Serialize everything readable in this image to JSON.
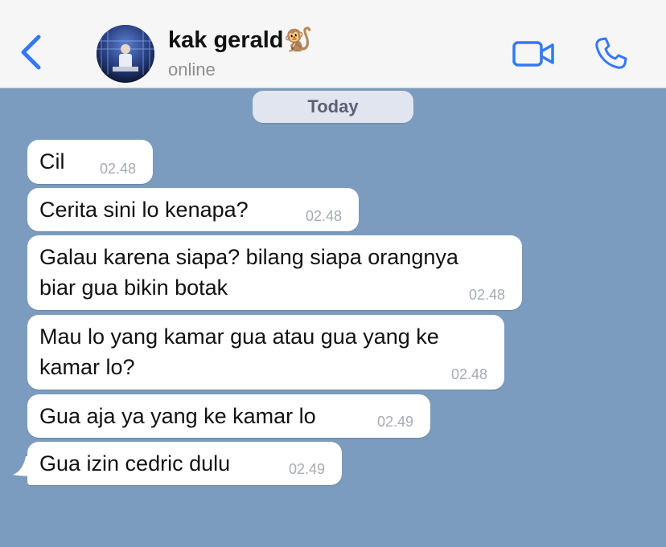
{
  "header": {
    "contact_name": "kak gerald",
    "contact_emoji": "🐒",
    "status": "online"
  },
  "chat": {
    "date_label": "Today",
    "messages": [
      {
        "lines": [
          "Cil"
        ],
        "time": "02.48"
      },
      {
        "lines": [
          "Cerita sini lo kenapa?"
        ],
        "time": "02.48"
      },
      {
        "lines": [
          "Galau karena siapa? bilang siapa orangnya",
          "biar gua bikin botak"
        ],
        "time": "02.48"
      },
      {
        "lines": [
          "Mau lo yang kamar gua atau gua yang ke",
          "kamar lo?"
        ],
        "time": "02.48"
      },
      {
        "lines": [
          "Gua aja ya yang ke kamar lo"
        ],
        "time": "02.49"
      },
      {
        "lines": [
          "Gua izin cedric dulu"
        ],
        "time": "02.49"
      }
    ]
  },
  "colors": {
    "accent": "#3478f6",
    "chat_background": "#7b9cbe",
    "bubble": "#ffffff",
    "header": "#f6f6f6"
  },
  "icons": [
    "back-chevron-icon",
    "video-camera-icon",
    "phone-icon"
  ]
}
